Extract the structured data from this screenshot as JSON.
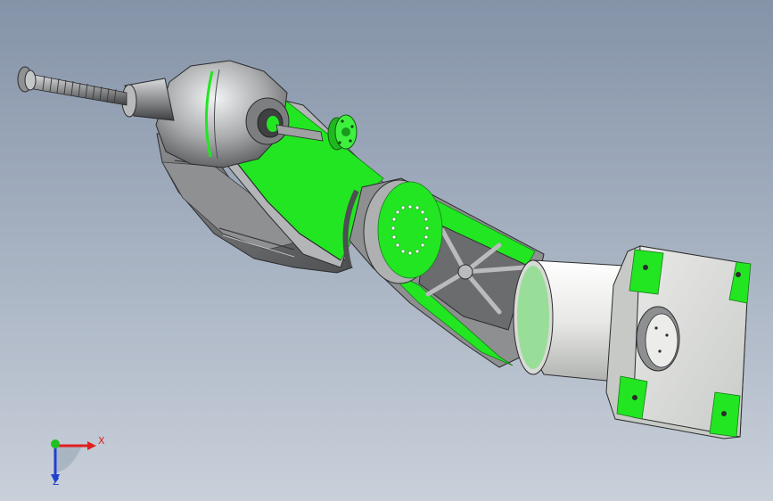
{
  "viewport": {
    "background_top": "#8593a8",
    "background_bottom": "#c9d0da"
  },
  "model": {
    "accent_color": "#22e622",
    "body_color": "#b9bbbd",
    "dark_color": "#6f7173",
    "light_color": "#e6e7e5",
    "housing_color": "#d9d9d6"
  },
  "triad": {
    "x_label": "X",
    "z_label": "Z",
    "x_color": "#e02020",
    "y_color": "#20c020",
    "z_color": "#2040d0"
  }
}
